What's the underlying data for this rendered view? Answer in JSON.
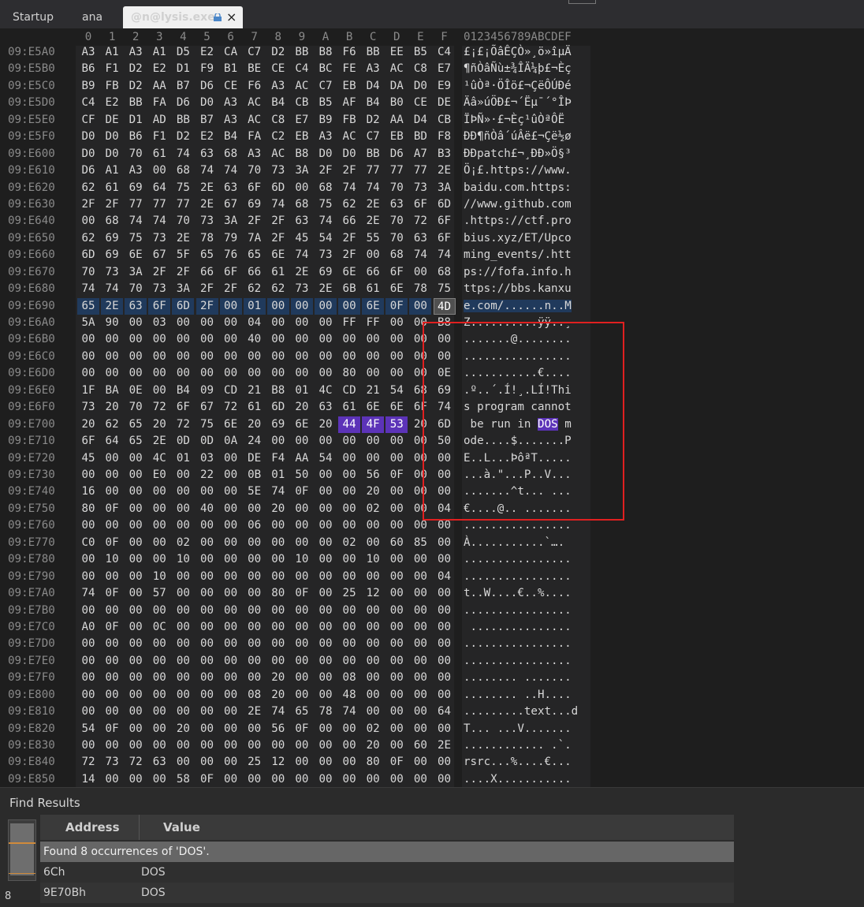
{
  "tabs": [
    {
      "label": "Startup"
    },
    {
      "label": "ana"
    },
    {
      "label": "@n@lysis.exe",
      "active": true
    }
  ],
  "hex": {
    "column_headers": [
      "0",
      "1",
      "2",
      "3",
      "4",
      "5",
      "6",
      "7",
      "8",
      "9",
      "A",
      "B",
      "C",
      "D",
      "E",
      "F"
    ],
    "ascii_header": "0123456789ABCDEF",
    "rows": [
      {
        "addr": "09:E5A0",
        "bytes": "A3 A1 A3 A1 D5 E2 CA C7 D2 BB B8 F6 BB EE B5 C4",
        "ascii": "£¡£¡ÕâÊÇÒ»¸ö»îµÄ"
      },
      {
        "addr": "09:E5B0",
        "bytes": "B6 F1 D2 E2 D1 F9 B1 BE CE C4 BC FE A3 AC C8 E7",
        "ascii": "¶ñÒâÑù±¾ÎÄ¼þ£¬Èç"
      },
      {
        "addr": "09:E5C0",
        "bytes": "B9 FB D2 AA B7 D6 CE F6 A3 AC C7 EB D4 DA D0 E9",
        "ascii": "¹ûÒª·ÖÎö£¬ÇëÔÚÐé"
      },
      {
        "addr": "09:E5D0",
        "bytes": "C4 E2 BB FA D6 D0 A3 AC B4 CB B5 AF B4 B0 CE DE",
        "ascii": "Äâ»úÖÐ£¬´Ëµ¯´°ÎÞ"
      },
      {
        "addr": "09:E5E0",
        "bytes": "CF DE D1 AD BB B7 A3 AC C8 E7 B9 FB D2 AA D4 CB",
        "ascii": "ÏÞÑ­»·£¬Èç¹ûÒªÔË"
      },
      {
        "addr": "09:E5F0",
        "bytes": "D0 D0 B6 F1 D2 E2 B4 FA C2 EB A3 AC C7 EB BD F8",
        "ascii": "ÐÐ¶ñÒâ´úÂë£¬Çë½ø"
      },
      {
        "addr": "09:E600",
        "bytes": "D0 D0 70 61 74 63 68 A3 AC B8 D0 D0 BB D6 A7 B3",
        "ascii": "ÐÐpatch£¬¸ÐÐ»Ö§³"
      },
      {
        "addr": "09:E610",
        "bytes": "D6 A1 A3 00 68 74 74 70 73 3A 2F 2F 77 77 77 2E",
        "ascii": "Ö¡£.https://www."
      },
      {
        "addr": "09:E620",
        "bytes": "62 61 69 64 75 2E 63 6F 6D 00 68 74 74 70 73 3A",
        "ascii": "baidu.com.https:"
      },
      {
        "addr": "09:E630",
        "bytes": "2F 2F 77 77 77 2E 67 69 74 68 75 62 2E 63 6F 6D",
        "ascii": "//www.github.com"
      },
      {
        "addr": "09:E640",
        "bytes": "00 68 74 74 70 73 3A 2F 2F 63 74 66 2E 70 72 6F",
        "ascii": ".https://ctf.pro"
      },
      {
        "addr": "09:E650",
        "bytes": "62 69 75 73 2E 78 79 7A 2F 45 54 2F 55 70 63 6F",
        "ascii": "bius.xyz/ET/Upco"
      },
      {
        "addr": "09:E660",
        "bytes": "6D 69 6E 67 5F 65 76 65 6E 74 73 2F 00 68 74 74",
        "ascii": "ming_events/.htt"
      },
      {
        "addr": "09:E670",
        "bytes": "70 73 3A 2F 2F 66 6F 66 61 2E 69 6E 66 6F 00 68",
        "ascii": "ps://fofa.info.h"
      },
      {
        "addr": "09:E680",
        "bytes": "74 74 70 73 3A 2F 2F 62 62 73 2E 6B 61 6E 78 75",
        "ascii": "ttps://bbs.kanxu"
      },
      {
        "addr": "09:E690",
        "bytes": "65 2E 63 6F 6D 2F 00 01 00 00 00 00 6E 0F 00 4D",
        "ascii": "e.com/......n..M"
      },
      {
        "addr": "09:E6A0",
        "bytes": "5A 90 00 03 00 00 00 04 00 00 00 FF FF 00 00 B8",
        "ascii": "Z..........ÿÿ..¸"
      },
      {
        "addr": "09:E6B0",
        "bytes": "00 00 00 00 00 00 00 40 00 00 00 00 00 00 00 00",
        "ascii": ".......@........"
      },
      {
        "addr": "09:E6C0",
        "bytes": "00 00 00 00 00 00 00 00 00 00 00 00 00 00 00 00",
        "ascii": "................"
      },
      {
        "addr": "09:E6D0",
        "bytes": "00 00 00 00 00 00 00 00 00 00 00 80 00 00 00 0E",
        "ascii": "...........€...."
      },
      {
        "addr": "09:E6E0",
        "bytes": "1F BA 0E 00 B4 09 CD 21 B8 01 4C CD 21 54 68 69",
        "ascii": ".º..´.Í!¸.LÍ!Thi"
      },
      {
        "addr": "09:E6F0",
        "bytes": "73 20 70 72 6F 67 72 61 6D 20 63 61 6E 6E 6F 74",
        "ascii": "s program cannot"
      },
      {
        "addr": "09:E700",
        "bytes": "20 62 65 20 72 75 6E 20 69 6E 20 44 4F 53 20 6D",
        "ascii": " be run in DOS m"
      },
      {
        "addr": "09:E710",
        "bytes": "6F 64 65 2E 0D 0D 0A 24 00 00 00 00 00 00 00 50",
        "ascii": "ode....$.......P"
      },
      {
        "addr": "09:E720",
        "bytes": "45 00 00 4C 01 03 00 DE F4 AA 54 00 00 00 00 00",
        "ascii": "E..L...ÞôªT....."
      },
      {
        "addr": "09:E730",
        "bytes": "00 00 00 E0 00 22 00 0B 01 50 00 00 56 0F 00 00",
        "ascii": "...à.\"...P..V..."
      },
      {
        "addr": "09:E740",
        "bytes": "16 00 00 00 00 00 00 5E 74 0F 00 00 20 00 00 00",
        "ascii": ".......^t... ..."
      },
      {
        "addr": "09:E750",
        "bytes": "80 0F 00 00 00 40 00 00 20 00 00 00 02 00 00 04",
        "ascii": "€....@.. ......."
      },
      {
        "addr": "09:E760",
        "bytes": "00 00 00 00 00 00 00 06 00 00 00 00 00 00 00 00",
        "ascii": "................"
      },
      {
        "addr": "09:E770",
        "bytes": "C0 0F 00 00 02 00 00 00 00 00 00 02 00 60 85 00",
        "ascii": "À...........`…."
      },
      {
        "addr": "09:E780",
        "bytes": "00 10 00 00 10 00 00 00 00 10 00 00 10 00 00 00",
        "ascii": "................"
      },
      {
        "addr": "09:E790",
        "bytes": "00 00 00 10 00 00 00 00 00 00 00 00 00 00 00 04",
        "ascii": "................"
      },
      {
        "addr": "09:E7A0",
        "bytes": "74 0F 00 57 00 00 00 00 80 0F 00 25 12 00 00 00",
        "ascii": "t..W....€..%...."
      },
      {
        "addr": "09:E7B0",
        "bytes": "00 00 00 00 00 00 00 00 00 00 00 00 00 00 00 00",
        "ascii": "................"
      },
      {
        "addr": "09:E7C0",
        "bytes": "A0 0F 00 0C 00 00 00 00 00 00 00 00 00 00 00 00",
        "ascii": " ..............."
      },
      {
        "addr": "09:E7D0",
        "bytes": "00 00 00 00 00 00 00 00 00 00 00 00 00 00 00 00",
        "ascii": "................"
      },
      {
        "addr": "09:E7E0",
        "bytes": "00 00 00 00 00 00 00 00 00 00 00 00 00 00 00 00",
        "ascii": "................"
      },
      {
        "addr": "09:E7F0",
        "bytes": "00 00 00 00 00 00 00 00 20 00 00 08 00 00 00 00",
        "ascii": "........ ......."
      },
      {
        "addr": "09:E800",
        "bytes": "00 00 00 00 00 00 00 08 20 00 00 48 00 00 00 00",
        "ascii": "........ ..H...."
      },
      {
        "addr": "09:E810",
        "bytes": "00 00 00 00 00 00 00 2E 74 65 78 74 00 00 00 64",
        "ascii": ".........text...d"
      },
      {
        "addr": "09:E820",
        "bytes": "54 0F 00 00 20 00 00 00 56 0F 00 00 02 00 00 00",
        "ascii": "T... ...V......."
      },
      {
        "addr": "09:E830",
        "bytes": "00 00 00 00 00 00 00 00 00 00 00 00 20 00 60 2E",
        "ascii": "............ .`."
      },
      {
        "addr": "09:E840",
        "bytes": "72 73 72 63 00 00 00 25 12 00 00 00 80 0F 00 00",
        "ascii": "rsrc...%....€..."
      },
      {
        "addr": "09:E850",
        "bytes": "14 00 00 00 58 0F 00 00 00 00 00 00 00 00 00 00",
        "ascii": "....X..........."
      }
    ],
    "selection": {
      "row": "09:E690",
      "from": 0,
      "to": 15
    },
    "cursor": {
      "row": "09:E690",
      "col": 15
    },
    "match": {
      "row": "09:E700",
      "from": 11,
      "to": 13
    }
  },
  "find_results": {
    "title": "Find Results",
    "columns": [
      "Address",
      "Value"
    ],
    "summary": "Found 8 occurrences of 'DOS'.",
    "rows": [
      {
        "address": "6Ch",
        "value": "DOS"
      },
      {
        "address": "9E70Bh",
        "value": "DOS"
      }
    ],
    "count": "8"
  },
  "colors": {
    "background": "#1e1e1e",
    "selection": "#203a5c",
    "match": "#5c33b8",
    "annotation_box": "#e02020"
  }
}
